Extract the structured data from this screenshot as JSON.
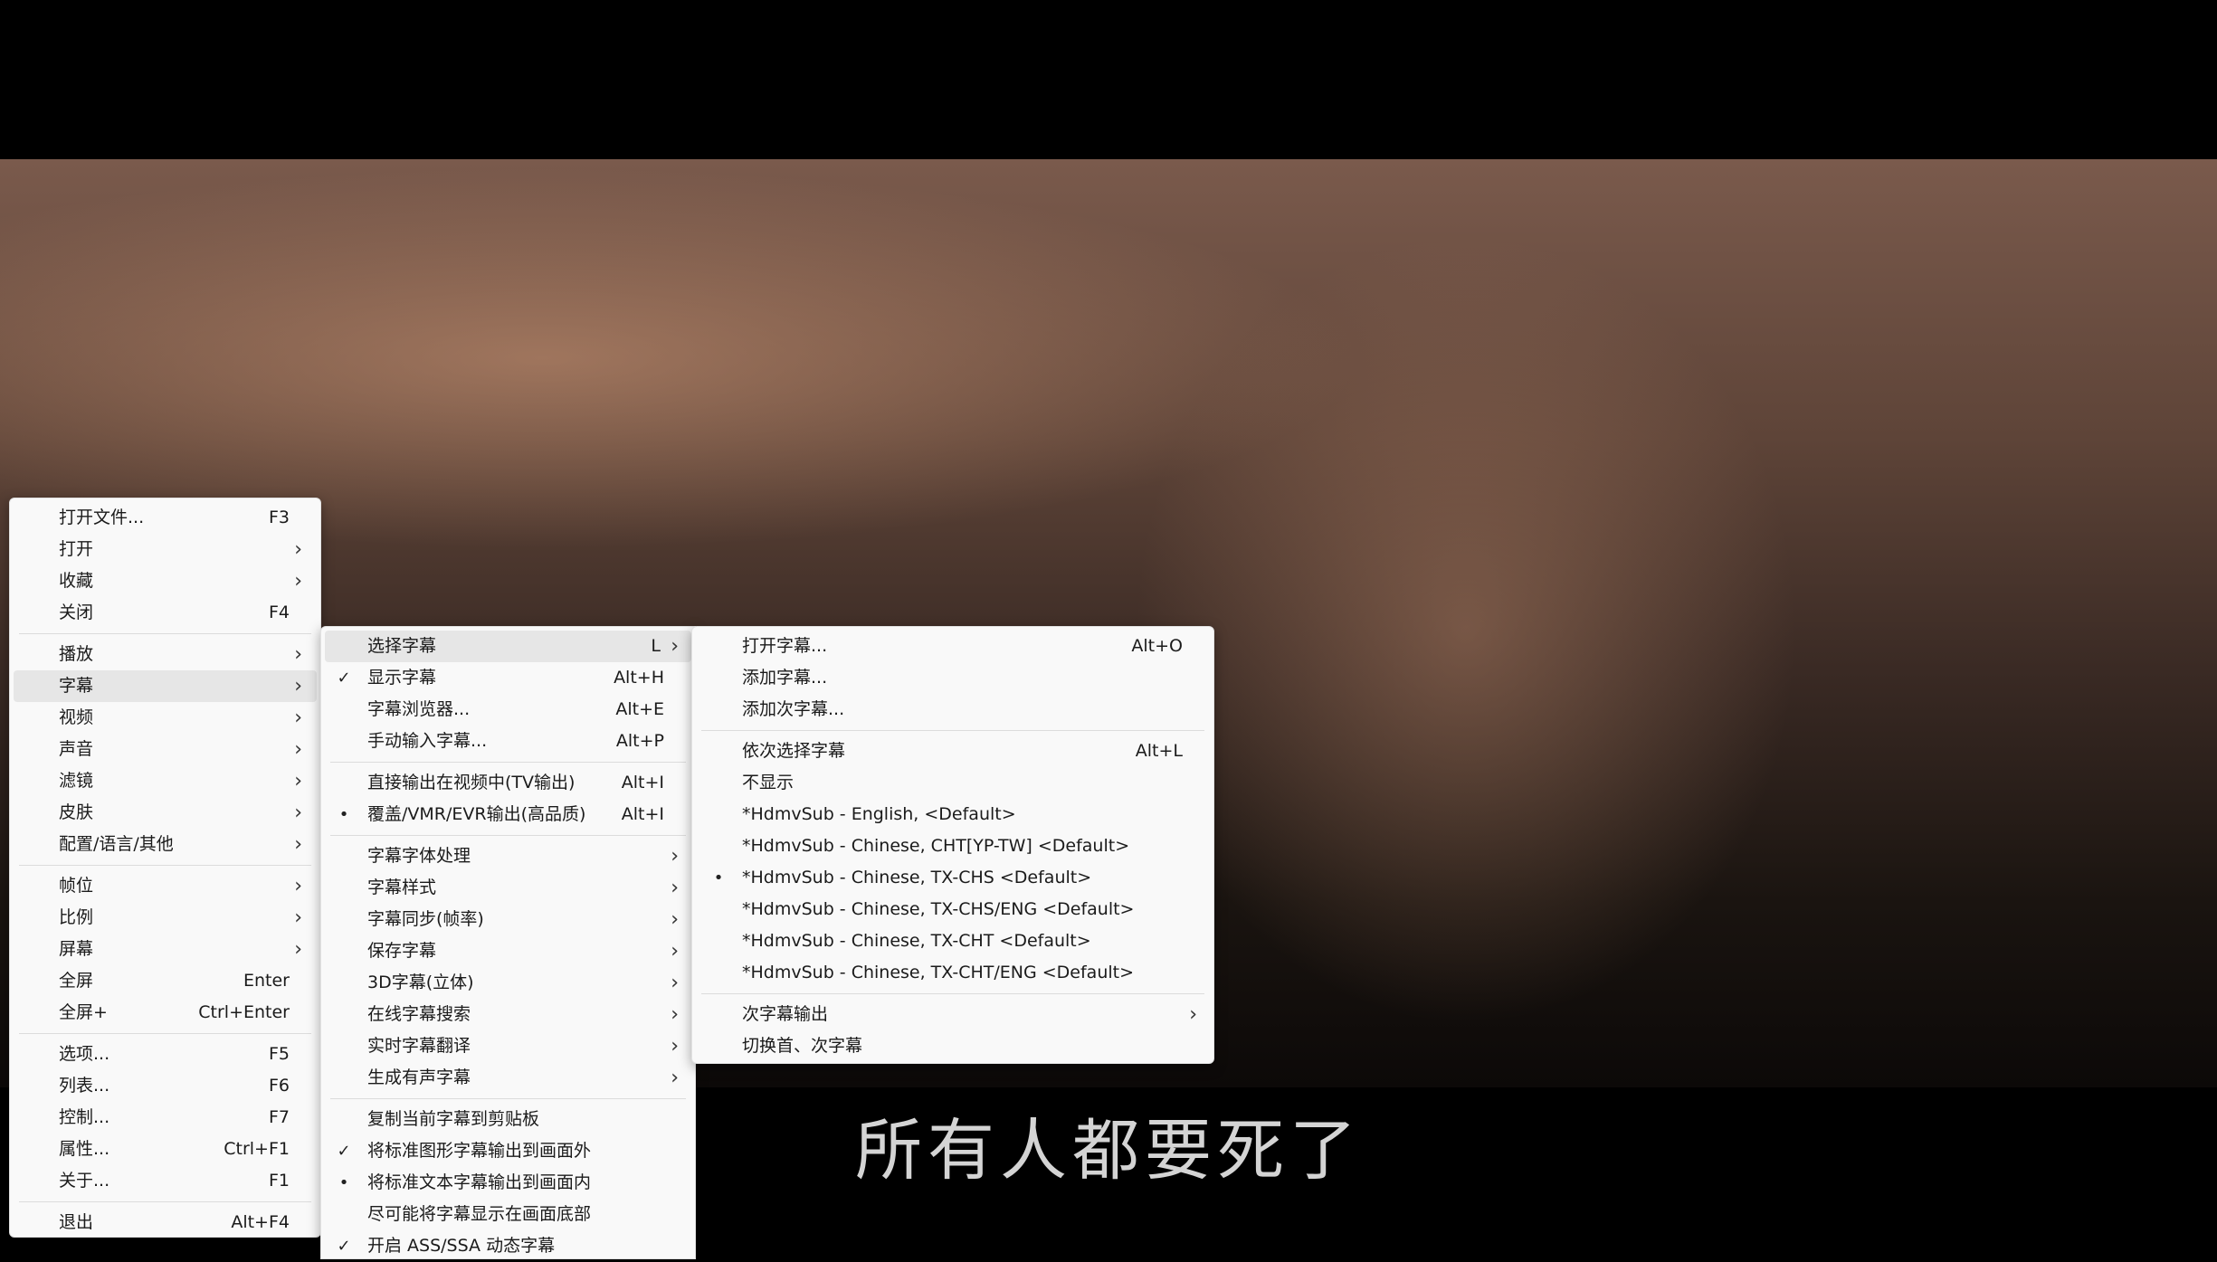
{
  "subtitle_text": "所有人都要死了",
  "menu1": {
    "groups": [
      [
        {
          "label": "打开文件...",
          "shortcut": "F3"
        },
        {
          "label": "打开",
          "submenu": true
        },
        {
          "label": "收藏",
          "submenu": true
        },
        {
          "label": "关闭",
          "shortcut": "F4"
        }
      ],
      [
        {
          "label": "播放",
          "submenu": true
        },
        {
          "label": "字幕",
          "submenu": true,
          "highlighted": true
        },
        {
          "label": "视频",
          "submenu": true
        },
        {
          "label": "声音",
          "submenu": true
        },
        {
          "label": "滤镜",
          "submenu": true
        },
        {
          "label": "皮肤",
          "submenu": true
        },
        {
          "label": "配置/语言/其他",
          "submenu": true
        }
      ],
      [
        {
          "label": "帧位",
          "submenu": true
        },
        {
          "label": "比例",
          "submenu": true
        },
        {
          "label": "屏幕",
          "submenu": true
        },
        {
          "label": "全屏",
          "shortcut": "Enter"
        },
        {
          "label": "全屏+",
          "shortcut": "Ctrl+Enter"
        }
      ],
      [
        {
          "label": "选项...",
          "shortcut": "F5"
        },
        {
          "label": "列表...",
          "shortcut": "F6"
        },
        {
          "label": "控制...",
          "shortcut": "F7"
        },
        {
          "label": "属性...",
          "shortcut": "Ctrl+F1"
        },
        {
          "label": "关于...",
          "shortcut": "F1"
        }
      ],
      [
        {
          "label": "退出",
          "shortcut": "Alt+F4"
        }
      ]
    ]
  },
  "menu2": {
    "groups": [
      [
        {
          "label": "选择字幕",
          "shortcut": "L",
          "submenu": true,
          "highlighted": true
        },
        {
          "label": "显示字幕",
          "shortcut": "Alt+H",
          "mark": "✓"
        },
        {
          "label": "字幕浏览器...",
          "shortcut": "Alt+E"
        },
        {
          "label": "手动输入字幕...",
          "shortcut": "Alt+P"
        }
      ],
      [
        {
          "label": "直接输出在视频中(TV输出)",
          "shortcut": "Alt+I"
        },
        {
          "label": "覆盖/VMR/EVR输出(高品质)",
          "shortcut": "Alt+I",
          "mark": "•"
        }
      ],
      [
        {
          "label": "字幕字体处理",
          "submenu": true
        },
        {
          "label": "字幕样式",
          "submenu": true
        },
        {
          "label": "字幕同步(帧率)",
          "submenu": true
        },
        {
          "label": "保存字幕",
          "submenu": true
        },
        {
          "label": "3D字幕(立体)",
          "submenu": true
        },
        {
          "label": "在线字幕搜索",
          "submenu": true
        },
        {
          "label": "实时字幕翻译",
          "submenu": true
        },
        {
          "label": "生成有声字幕",
          "submenu": true
        }
      ],
      [
        {
          "label": "复制当前字幕到剪贴板"
        },
        {
          "label": "将标准图形字幕输出到画面外",
          "mark": "✓"
        },
        {
          "label": "将标准文本字幕输出到画面内",
          "mark": "•"
        },
        {
          "label": "尽可能将字幕显示在画面底部"
        },
        {
          "label": "开启 ASS/SSA 动态字幕",
          "mark": "✓"
        }
      ]
    ]
  },
  "menu3": {
    "groups": [
      [
        {
          "label": "打开字幕...",
          "shortcut": "Alt+O"
        },
        {
          "label": "添加字幕..."
        },
        {
          "label": "添加次字幕..."
        }
      ],
      [
        {
          "label": "依次选择字幕",
          "shortcut": "Alt+L"
        },
        {
          "label": "不显示"
        },
        {
          "label": "*HdmvSub - English, <Default>"
        },
        {
          "label": "*HdmvSub - Chinese, CHT[YP-TW] <Default>"
        },
        {
          "label": "*HdmvSub - Chinese, TX-CHS <Default>",
          "mark": "•"
        },
        {
          "label": "*HdmvSub - Chinese, TX-CHS/ENG <Default>"
        },
        {
          "label": "*HdmvSub - Chinese, TX-CHT <Default>"
        },
        {
          "label": "*HdmvSub - Chinese, TX-CHT/ENG <Default>"
        }
      ],
      [
        {
          "label": "次字幕输出",
          "submenu": true
        },
        {
          "label": "切换首、次字幕"
        }
      ]
    ]
  }
}
